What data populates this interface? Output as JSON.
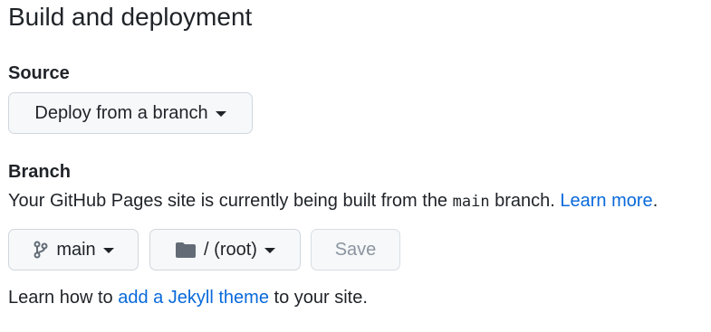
{
  "section": {
    "title": "Build and deployment"
  },
  "source": {
    "label": "Source",
    "selected": "Deploy from a branch"
  },
  "branch": {
    "label": "Branch",
    "description": {
      "prefix": "Your GitHub Pages site is currently being built from the ",
      "branch_code": "main",
      "suffix": " branch. ",
      "learn_more": "Learn more",
      "period": "."
    },
    "selected_branch": "main",
    "selected_folder": "/ (root)",
    "save_label": "Save"
  },
  "footer": {
    "prefix": "Learn how to ",
    "link": "add a Jekyll theme",
    "suffix": " to your site."
  },
  "icons": {
    "branch": "git-branch-icon",
    "folder": "folder-icon",
    "caret": "caret-down-icon"
  },
  "colors": {
    "link": "#0969da",
    "button_bg": "#f6f8fa",
    "border": "#d0d7de",
    "disabled_text": "#8c959f"
  }
}
